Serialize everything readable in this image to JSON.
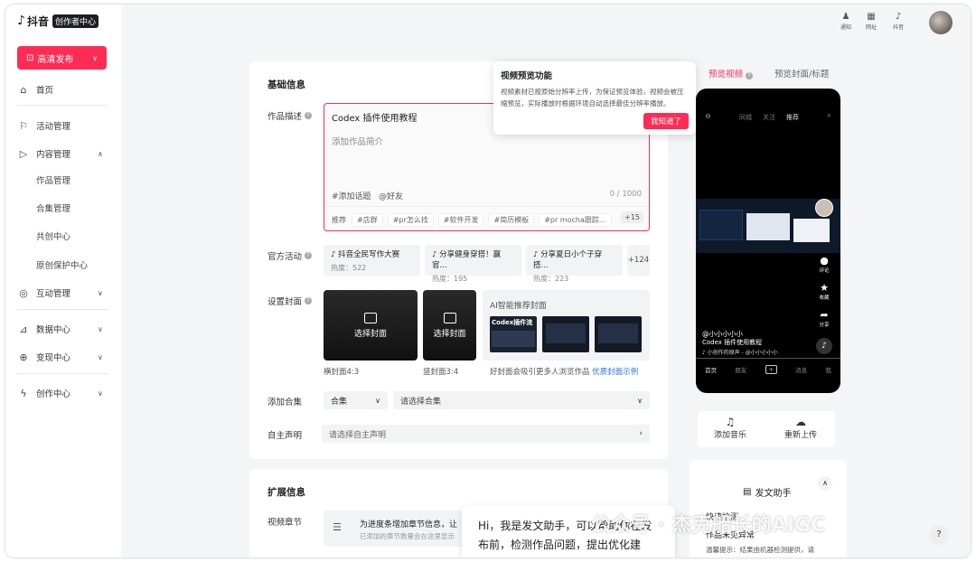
{
  "brand": {
    "name": "抖音",
    "badge": "创作者中心"
  },
  "publish": {
    "label": "高清发布"
  },
  "nav": {
    "home": "首页",
    "activity": "活动管理",
    "content": "内容管理",
    "works": "作品管理",
    "collections": "合集管理",
    "cocreate": "共创中心",
    "original": "原创保护中心",
    "interact": "互动管理",
    "data": "数据中心",
    "monetize": "变现中心",
    "creator": "创作中心"
  },
  "top": {
    "notify": "通知",
    "site": "网址",
    "douyin": "抖音"
  },
  "basic": {
    "title": "基础信息",
    "desc_label": "作品描述",
    "desc_value": "Codex 插件使用教程",
    "desc_placeholder": "添加作品简介",
    "add_topic": "#添加话题",
    "mention": "@好友",
    "count": "0 / 1000",
    "rec_label": "推荐",
    "rec_tags": [
      "#店群",
      "#pr怎么找",
      "#软件开发",
      "#简历模板",
      "#pr mocha跟踪..."
    ],
    "rec_more": "+15",
    "act_label": "官方活动",
    "activities": [
      {
        "title": "抖音全民写作大赛",
        "heat": "热度：522"
      },
      {
        "title": "分享健身穿搭！赢官...",
        "heat": "热度：195"
      },
      {
        "title": "分享夏日小个子穿搭...",
        "heat": "热度：223"
      }
    ],
    "act_more": "+124",
    "cover_label": "设置封面",
    "choose_cover": "选择封面",
    "landscape": "横封面4:3",
    "portrait": "竖封面3:4",
    "ai_title": "AI智能推荐封面",
    "ai_hint": "好封面会吸引更多人浏览作品",
    "ai_link": "优质封面示例",
    "collection_label": "添加合集",
    "collection_type": "合集",
    "collection_placeholder": "请选择合集",
    "statement_label": "自主声明",
    "statement_placeholder": "请选择自主声明"
  },
  "ext": {
    "title": "扩展信息",
    "chapter_label": "视频章节",
    "chapter_text": "为进度条增加章节信息，让",
    "chapter_sub": "已添加的章节数量会在这里显示"
  },
  "tip": {
    "title": "视频预览功能",
    "body": "视频素材已按原始分辨率上传，为保证预览体验，视频会被压缩预览，实际播放时根据环境自动选择最佳分辨率播放。",
    "btn": "我知道了"
  },
  "preview": {
    "tab_video": "预览视频",
    "tab_cover": "预览封面/标题",
    "user": "@小小小小小",
    "caption": "Codex 插件使用教程",
    "music": "小创作的原声 - @小小小小小",
    "comment": "评论",
    "collect": "收藏",
    "share": "分享",
    "tabs": [
      "首页",
      "朋友",
      "",
      "消息",
      "我"
    ],
    "phone_top": [
      "同城",
      "关注",
      "推荐"
    ],
    "mini_title": "Codex插件流"
  },
  "tools": {
    "music": "添加音乐",
    "reupload": "重新上传"
  },
  "assistant": {
    "title": "发文助手",
    "quick": "快速检测",
    "no_issue": "作品未见异常",
    "hint": "温馨提示：结果由机器检测提供，请",
    "greet": "Hi，我是发文助手，可以帮助你在发布前，检测作品问题，提出优化建"
  },
  "watermark": "公众号 · 杰克船长的AIGC"
}
